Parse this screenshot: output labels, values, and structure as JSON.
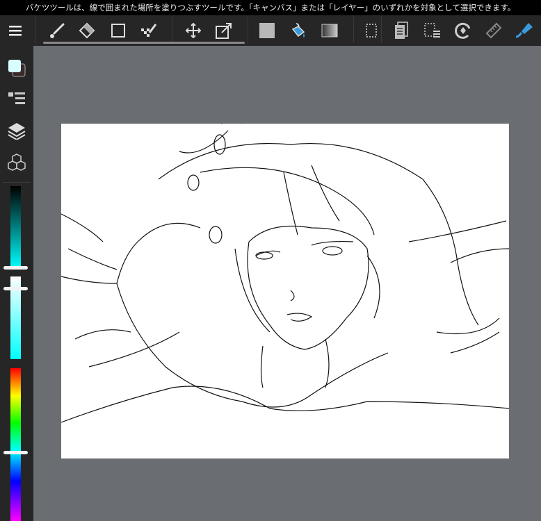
{
  "hint_text": "バケツツールは、線で囲まれた場所を塗りつぶすツールです。「キャンバス」または「レイヤー」のいずれかを対象として選択できます。",
  "toolbar": {
    "tools": [
      "menu-icon",
      "brush-icon",
      "eraser-icon",
      "rectangle-icon",
      "dot-brush-icon",
      "move-icon",
      "transform-icon",
      "fill-color-icon",
      "bucket-icon",
      "gradient-icon",
      "select-icon",
      "layer-copy-icon",
      "select-menu-icon",
      "rotate-icon",
      "ruler-icon",
      "snap-icon"
    ]
  },
  "sidebar": {
    "items": [
      "color-swatch",
      "brush-list",
      "layers",
      "materials"
    ]
  },
  "colors": {
    "foreground": "#d8ffff",
    "background": "#3a2a2a",
    "accent": "#3a9ad9"
  },
  "color_sliders": {
    "brightness": 1.0,
    "saturation": 0.08,
    "hue_degrees": 180
  }
}
